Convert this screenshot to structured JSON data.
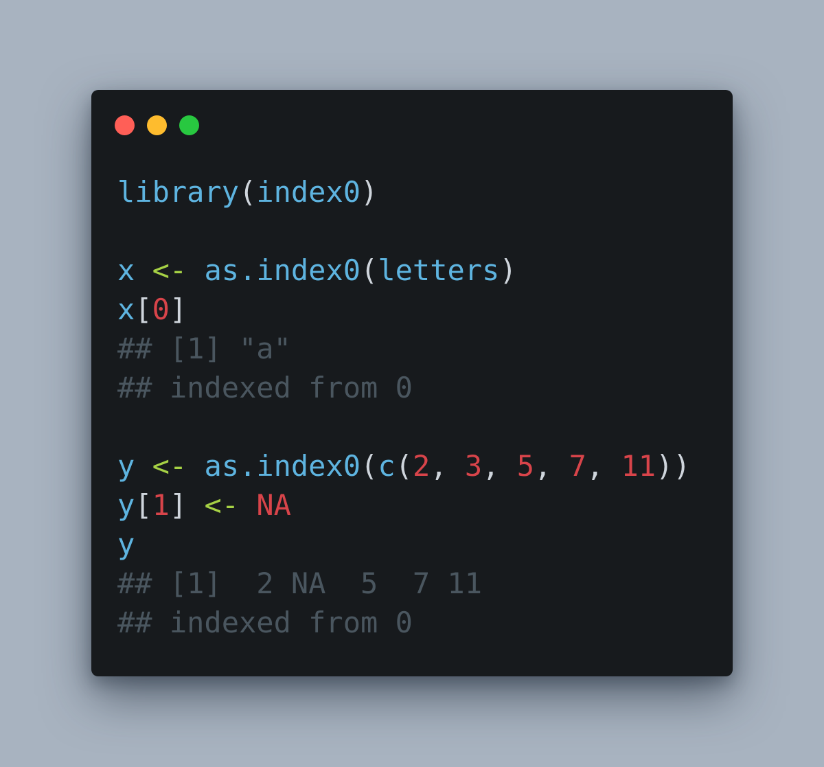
{
  "window": {
    "controls": [
      {
        "name": "close",
        "color": "#ff5f57"
      },
      {
        "name": "minimize",
        "color": "#febc2e"
      },
      {
        "name": "zoom",
        "color": "#28c840"
      }
    ]
  },
  "colors": {
    "background": "#a8b3c0",
    "window": "#171a1d",
    "function": "#5eb4e0",
    "operator": "#a6d145",
    "number": "#d8444a",
    "comment": "#4a565f",
    "punctuation": "#cfd5dc"
  },
  "code_lines": [
    [
      {
        "text": "library",
        "kind": "function"
      },
      {
        "text": "(",
        "kind": "punctuation"
      },
      {
        "text": "index0",
        "kind": "function"
      },
      {
        "text": ")",
        "kind": "punctuation"
      }
    ],
    [],
    [
      {
        "text": "x",
        "kind": "function"
      },
      {
        "text": " ",
        "kind": "punctuation"
      },
      {
        "text": "<-",
        "kind": "operator"
      },
      {
        "text": " ",
        "kind": "punctuation"
      },
      {
        "text": "as.index0",
        "kind": "function"
      },
      {
        "text": "(",
        "kind": "punctuation"
      },
      {
        "text": "letters",
        "kind": "function"
      },
      {
        "text": ")",
        "kind": "punctuation"
      }
    ],
    [
      {
        "text": "x",
        "kind": "function"
      },
      {
        "text": "[",
        "kind": "punctuation"
      },
      {
        "text": "0",
        "kind": "number"
      },
      {
        "text": "]",
        "kind": "punctuation"
      }
    ],
    [
      {
        "text": "## [1] \"a\"",
        "kind": "comment"
      }
    ],
    [
      {
        "text": "## indexed from 0",
        "kind": "comment"
      }
    ],
    [],
    [
      {
        "text": "y",
        "kind": "function"
      },
      {
        "text": " ",
        "kind": "punctuation"
      },
      {
        "text": "<-",
        "kind": "operator"
      },
      {
        "text": " ",
        "kind": "punctuation"
      },
      {
        "text": "as.index0",
        "kind": "function"
      },
      {
        "text": "(",
        "kind": "punctuation"
      },
      {
        "text": "c",
        "kind": "function"
      },
      {
        "text": "(",
        "kind": "punctuation"
      },
      {
        "text": "2",
        "kind": "number"
      },
      {
        "text": ", ",
        "kind": "punctuation"
      },
      {
        "text": "3",
        "kind": "number"
      },
      {
        "text": ", ",
        "kind": "punctuation"
      },
      {
        "text": "5",
        "kind": "number"
      },
      {
        "text": ", ",
        "kind": "punctuation"
      },
      {
        "text": "7",
        "kind": "number"
      },
      {
        "text": ", ",
        "kind": "punctuation"
      },
      {
        "text": "11",
        "kind": "number"
      },
      {
        "text": "))",
        "kind": "punctuation"
      }
    ],
    [
      {
        "text": "y",
        "kind": "function"
      },
      {
        "text": "[",
        "kind": "punctuation"
      },
      {
        "text": "1",
        "kind": "number"
      },
      {
        "text": "]",
        "kind": "punctuation"
      },
      {
        "text": " ",
        "kind": "punctuation"
      },
      {
        "text": "<-",
        "kind": "operator"
      },
      {
        "text": " ",
        "kind": "punctuation"
      },
      {
        "text": "NA",
        "kind": "number"
      }
    ],
    [
      {
        "text": "y",
        "kind": "function"
      }
    ],
    [
      {
        "text": "## [1]  2 NA  5  7 11",
        "kind": "comment"
      }
    ],
    [
      {
        "text": "## indexed from 0",
        "kind": "comment"
      }
    ]
  ]
}
